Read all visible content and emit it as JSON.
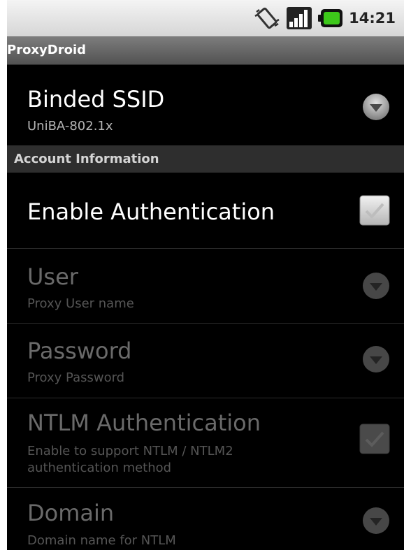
{
  "status_bar": {
    "time": "14:21"
  },
  "app": {
    "title": "ProxyDroid"
  },
  "preferences": {
    "binded_ssid": {
      "title": "Binded SSID",
      "summary": "UniBA-802.1x"
    },
    "account_header": "Account Information",
    "enable_auth": {
      "title": "Enable Authentication",
      "checked": true
    },
    "user": {
      "title": "User",
      "summary": "Proxy User name",
      "enabled": false
    },
    "password": {
      "title": "Password",
      "summary": "Proxy Password",
      "enabled": false
    },
    "ntlm": {
      "title": "NTLM Authentication",
      "summary_line1": "Enable to support NTLM / NTLM2",
      "summary_line2": "authentication method",
      "checked": true,
      "enabled": false
    },
    "domain": {
      "title": "Domain",
      "summary": "Domain name for NTLM",
      "enabled": false
    }
  },
  "colors": {
    "background": "#000000",
    "title_bar": "#6a6a6a",
    "category_header": "#2e2e2e",
    "disabled_text": "#6a6a6a"
  },
  "icons": [
    "vibrate-icon",
    "signal-icon",
    "battery-icon",
    "dropdown-icon",
    "checkbox-icon"
  ]
}
